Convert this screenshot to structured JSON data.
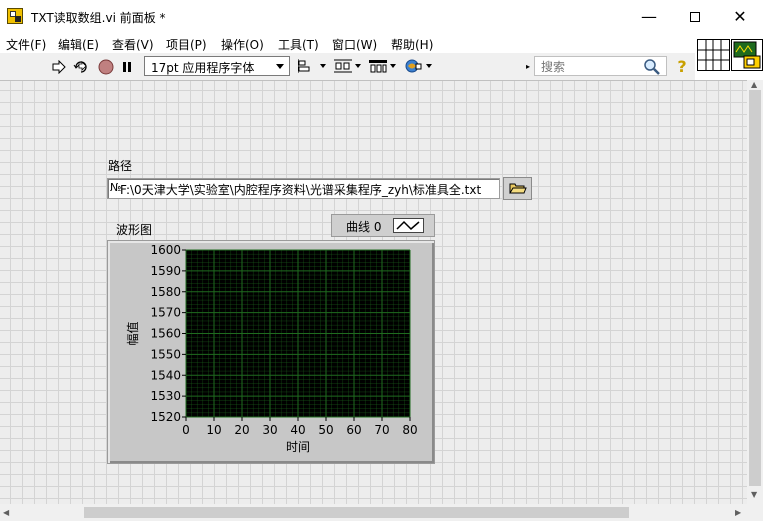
{
  "window": {
    "title": "TXT读取数组.vi 前面板 *"
  },
  "menu": [
    "文件(F)",
    "编辑(E)",
    "查看(V)",
    "项目(P)",
    "操作(O)",
    "工具(T)",
    "窗口(W)",
    "帮助(H)"
  ],
  "toolbar": {
    "font": "17pt 应用程序字体",
    "search_placeholder": "搜索"
  },
  "path_control": {
    "label": "路径",
    "value": "F:\\0天津大学\\实验室\\内腔程序资料\\光谱采集程序_zyh\\标准具全.txt"
  },
  "waveform": {
    "label": "波形图",
    "legend": "曲线 0"
  },
  "chart_data": {
    "type": "line",
    "xlabel": "时间",
    "ylabel": "幅值",
    "xlim": [
      0,
      80
    ],
    "ylim": [
      1520,
      1600
    ],
    "xticks": [
      "0",
      "10",
      "20",
      "30",
      "40",
      "50",
      "60",
      "70",
      "80"
    ],
    "yticks": [
      "1600",
      "1590",
      "1580",
      "1570",
      "1560",
      "1550",
      "1540",
      "1530",
      "1520"
    ],
    "grid": true,
    "series": [
      {
        "name": "曲线 0",
        "values": []
      }
    ],
    "colors": {
      "plot_bg": "#000000",
      "grid": "#1f6b1f"
    }
  }
}
